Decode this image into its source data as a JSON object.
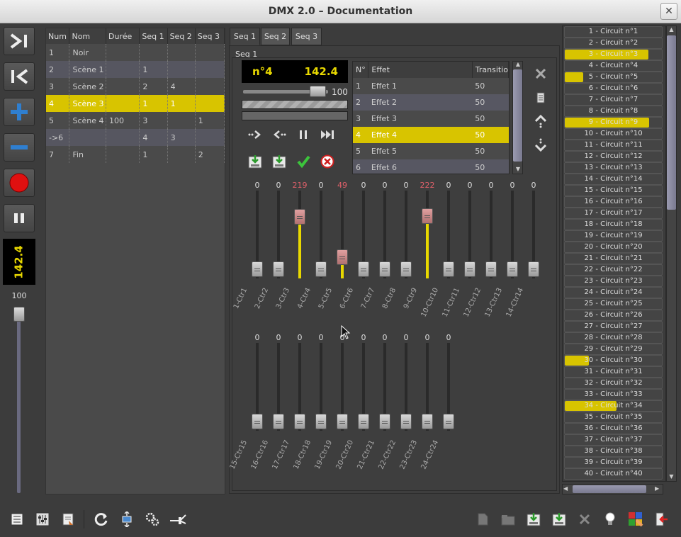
{
  "window": {
    "title": "DMX 2.0 – Documentation",
    "close": "✕"
  },
  "left": {
    "tempo": "142.4",
    "master_pct": "100"
  },
  "seq_table": {
    "headers": [
      "Num",
      "Nom",
      "Durée",
      "Seq 1",
      "Seq 2",
      "Seq 3"
    ],
    "rows": [
      [
        "1",
        "Noir",
        "",
        "",
        "",
        ""
      ],
      [
        "2",
        "Scène 1",
        "",
        "1",
        "",
        ""
      ],
      [
        "3",
        "Scène 2",
        "",
        "2",
        "4",
        ""
      ],
      [
        "4",
        "Scène 3",
        "",
        "1",
        "1",
        ""
      ],
      [
        "5",
        "Scène 4",
        "100",
        "3",
        "",
        "1"
      ],
      [
        "->6",
        "",
        "",
        "4",
        "3",
        ""
      ],
      [
        "7",
        "Fin",
        "",
        "1",
        "",
        "2"
      ]
    ],
    "selected_row": 3
  },
  "tabs": [
    "Seq 1",
    "Seq 2",
    "Seq 3"
  ],
  "seq_label": "Seq 1",
  "display": {
    "step": "n°4",
    "tempo": "142.4"
  },
  "master": {
    "pct": "100",
    "level": 1.0
  },
  "effects": {
    "headers": [
      "N°",
      "Effet",
      "Transitio"
    ],
    "rows": [
      [
        "1",
        "Effet 1",
        "50"
      ],
      [
        "2",
        "Effet 2",
        "50"
      ],
      [
        "3",
        "Effet 3",
        "50"
      ],
      [
        "4",
        "Effet 4",
        "50"
      ],
      [
        "5",
        "Effet 5",
        "50"
      ],
      [
        "6",
        "Effet 6",
        "50"
      ]
    ],
    "selected_row": 3
  },
  "faders_row1": [
    {
      "label": "1-Ctr1",
      "value": 0
    },
    {
      "label": "2-Ctr2",
      "value": 0
    },
    {
      "label": "3-Ctr3",
      "value": 219
    },
    {
      "label": "4-Ctr4",
      "value": 0
    },
    {
      "label": "5-Ctr5",
      "value": 49
    },
    {
      "label": "6-Ctr6",
      "value": 0
    },
    {
      "label": "7-Ctr7",
      "value": 0
    },
    {
      "label": "8-Ctr8",
      "value": 0
    },
    {
      "label": "9-Ctr9",
      "value": 222
    },
    {
      "label": "10-Ctr10",
      "value": 0
    },
    {
      "label": "11-Ctr11",
      "value": 0
    },
    {
      "label": "12-Ctr12",
      "value": 0
    },
    {
      "label": "13-Ctr13",
      "value": 0
    },
    {
      "label": "14-Ctr14",
      "value": 0
    }
  ],
  "faders_row2": [
    {
      "label": "15-Ctr15",
      "value": 0
    },
    {
      "label": "16-Ctr16",
      "value": 0
    },
    {
      "label": "17-Ctr17",
      "value": 0
    },
    {
      "label": "18-Ctr18",
      "value": 0
    },
    {
      "label": "19-Ctr19",
      "value": 0
    },
    {
      "label": "20-Ctr20",
      "value": 0
    },
    {
      "label": "21-Ctr21",
      "value": 0
    },
    {
      "label": "22-Ctr22",
      "value": 0
    },
    {
      "label": "23-Ctr23",
      "value": 0
    },
    {
      "label": "24-Ctr24",
      "value": 0
    }
  ],
  "channels": [
    {
      "label": "1 - Circuit n°1",
      "level": 0
    },
    {
      "label": "2 - Circuit n°2",
      "level": 0
    },
    {
      "label": "3 - Circuit n°3",
      "level": 0.86
    },
    {
      "label": "4 - Circuit n°4",
      "level": 0
    },
    {
      "label": "5 - Circuit n°5",
      "level": 0.19
    },
    {
      "label": "6 - Circuit n°6",
      "level": 0
    },
    {
      "label": "7 - Circuit n°7",
      "level": 0
    },
    {
      "label": "8 - Circuit n°8",
      "level": 0
    },
    {
      "label": "9 - Circuit n°9",
      "level": 0.87
    },
    {
      "label": "10 - Circuit n°10",
      "level": 0
    },
    {
      "label": "11 - Circuit n°11",
      "level": 0
    },
    {
      "label": "12 - Circuit n°12",
      "level": 0
    },
    {
      "label": "13 - Circuit n°13",
      "level": 0
    },
    {
      "label": "14 - Circuit n°14",
      "level": 0
    },
    {
      "label": "15 - Circuit n°15",
      "level": 0
    },
    {
      "label": "16 - Circuit n°16",
      "level": 0
    },
    {
      "label": "17 - Circuit n°17",
      "level": 0
    },
    {
      "label": "18 - Circuit n°18",
      "level": 0
    },
    {
      "label": "19 - Circuit n°19",
      "level": 0
    },
    {
      "label": "20 - Circuit n°20",
      "level": 0
    },
    {
      "label": "21 - Circuit n°21",
      "level": 0
    },
    {
      "label": "22 - Circuit n°22",
      "level": 0
    },
    {
      "label": "23 - Circuit n°23",
      "level": 0
    },
    {
      "label": "24 - Circuit n°24",
      "level": 0
    },
    {
      "label": "25 - Circuit n°25",
      "level": 0
    },
    {
      "label": "26 - Circuit n°26",
      "level": 0
    },
    {
      "label": "27 - Circuit n°27",
      "level": 0
    },
    {
      "label": "28 - Circuit n°28",
      "level": 0
    },
    {
      "label": "29 - Circuit n°29",
      "level": 0
    },
    {
      "label": "30 - Circuit n°30",
      "level": 0.25
    },
    {
      "label": "31 - Circuit n°31",
      "level": 0
    },
    {
      "label": "32 - Circuit n°32",
      "level": 0
    },
    {
      "label": "33 - Circuit n°33",
      "level": 0
    },
    {
      "label": "34 - Circuit n°34",
      "level": 0.53
    },
    {
      "label": "35 - Circuit n°35",
      "level": 0
    },
    {
      "label": "36 - Circuit n°36",
      "level": 0
    },
    {
      "label": "37 - Circuit n°37",
      "level": 0
    },
    {
      "label": "38 - Circuit n°38",
      "level": 0
    },
    {
      "label": "39 - Circuit n°39",
      "level": 0
    },
    {
      "label": "40 - Circuit n°40",
      "level": 0
    }
  ],
  "colors": {
    "accent": "#d8c400",
    "hot_value": "#e0606a",
    "record": "#e01010",
    "add": "#2f7fd0"
  }
}
